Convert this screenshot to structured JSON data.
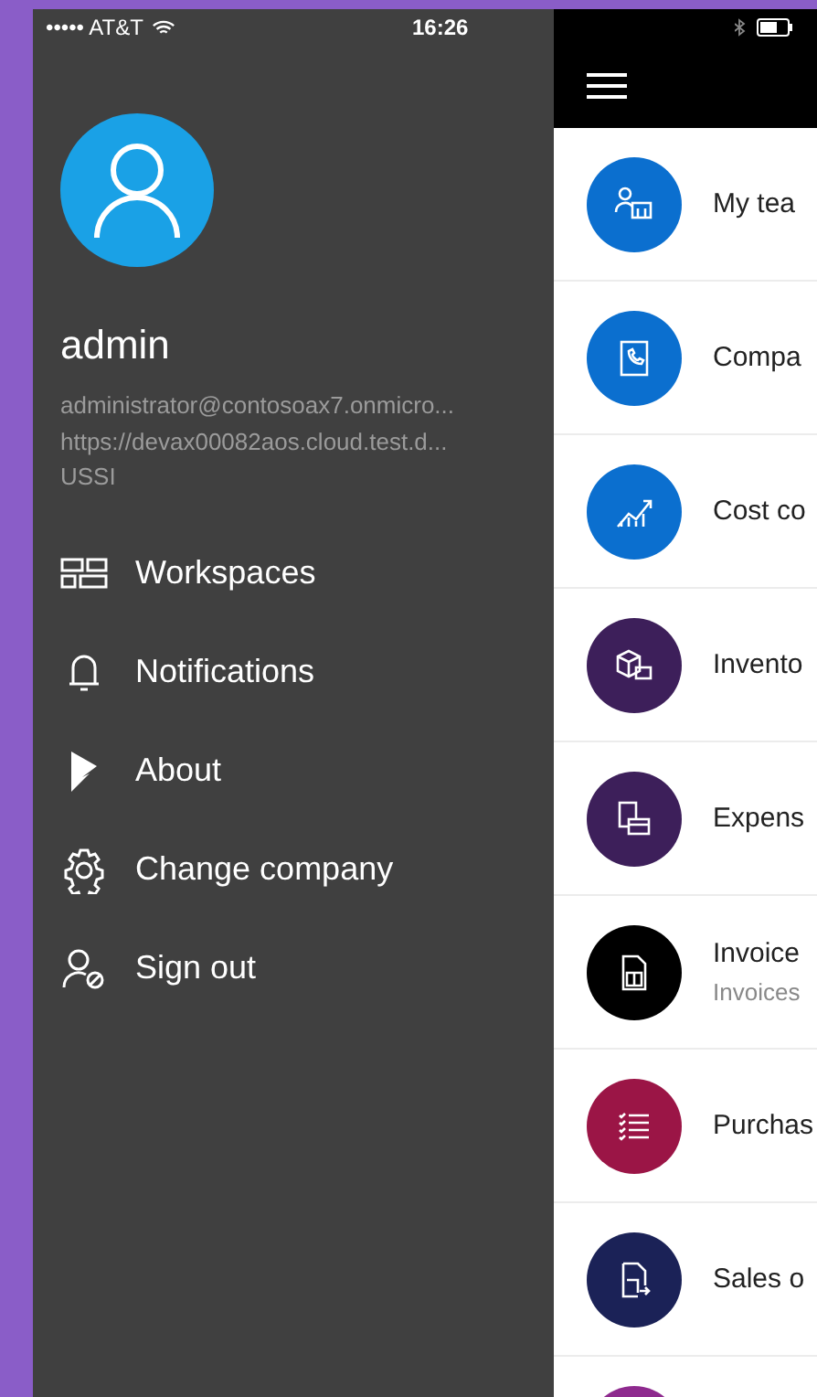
{
  "status_bar": {
    "carrier": "••••• AT&T",
    "time": "16:26"
  },
  "drawer": {
    "user_name": "admin",
    "account_lines": [
      "administrator@contosoax7.onmicro...",
      "https://devax00082aos.cloud.test.d...",
      "USSI"
    ],
    "menu": [
      {
        "label": "Workspaces",
        "kind": "workspaces"
      },
      {
        "label": "Notifications",
        "kind": "notifications"
      },
      {
        "label": "About",
        "kind": "about"
      },
      {
        "label": "Change company",
        "kind": "settings"
      },
      {
        "label": "Sign out",
        "kind": "signout"
      }
    ]
  },
  "workspaces": [
    {
      "title": "My tea",
      "kind": "team",
      "color": "#0b6fcf"
    },
    {
      "title": "Compa",
      "kind": "contact",
      "color": "#0b6fcf"
    },
    {
      "title": "Cost co",
      "kind": "chart",
      "color": "#0b6fcf"
    },
    {
      "title": "Invento",
      "kind": "inventory",
      "color": "#3d1f5a"
    },
    {
      "title": "Expens",
      "kind": "expense",
      "color": "#3d1f5a"
    },
    {
      "title": "Invoice",
      "subtitle": "Invoices",
      "kind": "document",
      "color": "#000000"
    },
    {
      "title": "Purchas",
      "kind": "list",
      "color": "#9b1546"
    },
    {
      "title": "Sales o",
      "kind": "document-arrow",
      "color": "#1b2257"
    },
    {
      "kind": "none",
      "color": "#8e2a8e"
    }
  ]
}
